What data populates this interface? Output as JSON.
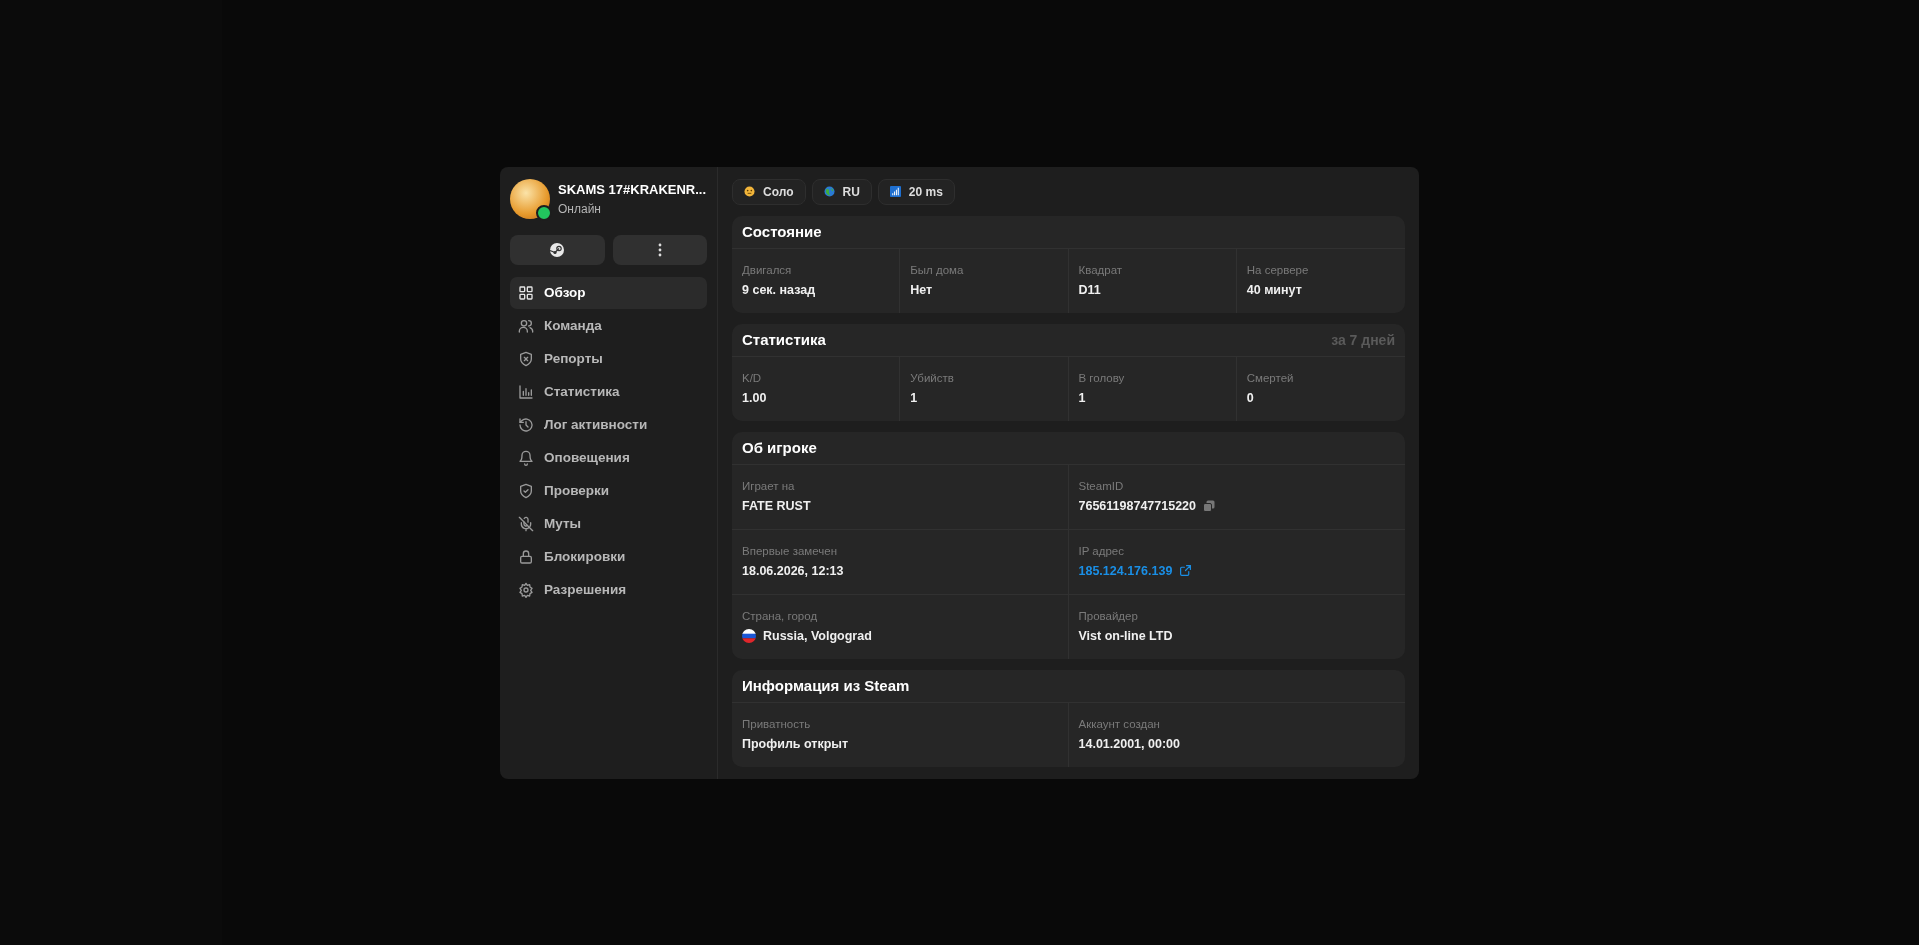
{
  "profile": {
    "name": "SKAMS 17#KRAKENR...",
    "status": "Онлайн",
    "online": true
  },
  "nav": [
    {
      "kind": "grid",
      "label": "Обзор",
      "selected": true
    },
    {
      "kind": "users",
      "label": "Команда",
      "selected": false
    },
    {
      "kind": "shield-x",
      "label": "Репорты",
      "selected": false
    },
    {
      "kind": "chart",
      "label": "Статистика",
      "selected": false
    },
    {
      "kind": "history",
      "label": "Лог активности",
      "selected": false
    },
    {
      "kind": "bell",
      "label": "Оповещения",
      "selected": false
    },
    {
      "kind": "shield-check",
      "label": "Проверки",
      "selected": false
    },
    {
      "kind": "mic-off",
      "label": "Муты",
      "selected": false
    },
    {
      "kind": "lock",
      "label": "Блокировки",
      "selected": false
    },
    {
      "kind": "gear",
      "label": "Разрешения",
      "selected": false
    }
  ],
  "chips": [
    {
      "kind": "face",
      "label": "Соло"
    },
    {
      "kind": "globe",
      "label": "RU"
    },
    {
      "kind": "signal",
      "label": "20 ms"
    }
  ],
  "sections": [
    {
      "title": "Состояние",
      "kind": "row",
      "fields": [
        {
          "label": "Двигался",
          "value": "9 сек. назад",
          "kind": "text"
        },
        {
          "label": "Был дома",
          "value": "Нет",
          "kind": "text"
        },
        {
          "label": "Квадрат",
          "value": "D11",
          "kind": "text"
        },
        {
          "label": "На сервере",
          "value": "40 минут",
          "kind": "text"
        }
      ]
    },
    {
      "title": "Статистика",
      "note": "за 7 дней",
      "kind": "row",
      "fields": [
        {
          "label": "K/D",
          "value": "1.00",
          "kind": "text"
        },
        {
          "label": "Убийств",
          "value": "1",
          "kind": "text"
        },
        {
          "label": "В голову",
          "value": "1",
          "kind": "text"
        },
        {
          "label": "Смертей",
          "value": "0",
          "kind": "text"
        }
      ]
    },
    {
      "title": "Об игроке",
      "kind": "grid",
      "fields": [
        {
          "label": "Играет на",
          "value": "FATE RUST",
          "kind": "text"
        },
        {
          "label": "SteamID",
          "value": "76561198747715220",
          "kind": "copy"
        },
        {
          "label": "Впервые замечен",
          "value": "18.06.2026, 12:13",
          "kind": "text"
        },
        {
          "label": "IP адрес",
          "value": "185.124.176.139",
          "kind": "link"
        },
        {
          "label": "Страна, город",
          "value": "Russia, Volgograd",
          "kind": "flag"
        },
        {
          "label": "Провайдер",
          "value": "Vist on-line LTD",
          "kind": "text"
        }
      ]
    },
    {
      "title": "Информация из Steam",
      "kind": "grid",
      "fields": [
        {
          "label": "Приватность",
          "value": "Профиль открыт",
          "kind": "text"
        },
        {
          "label": "Аккаунт создан",
          "value": "14.01.2001, 00:00",
          "kind": "text"
        }
      ]
    }
  ]
}
